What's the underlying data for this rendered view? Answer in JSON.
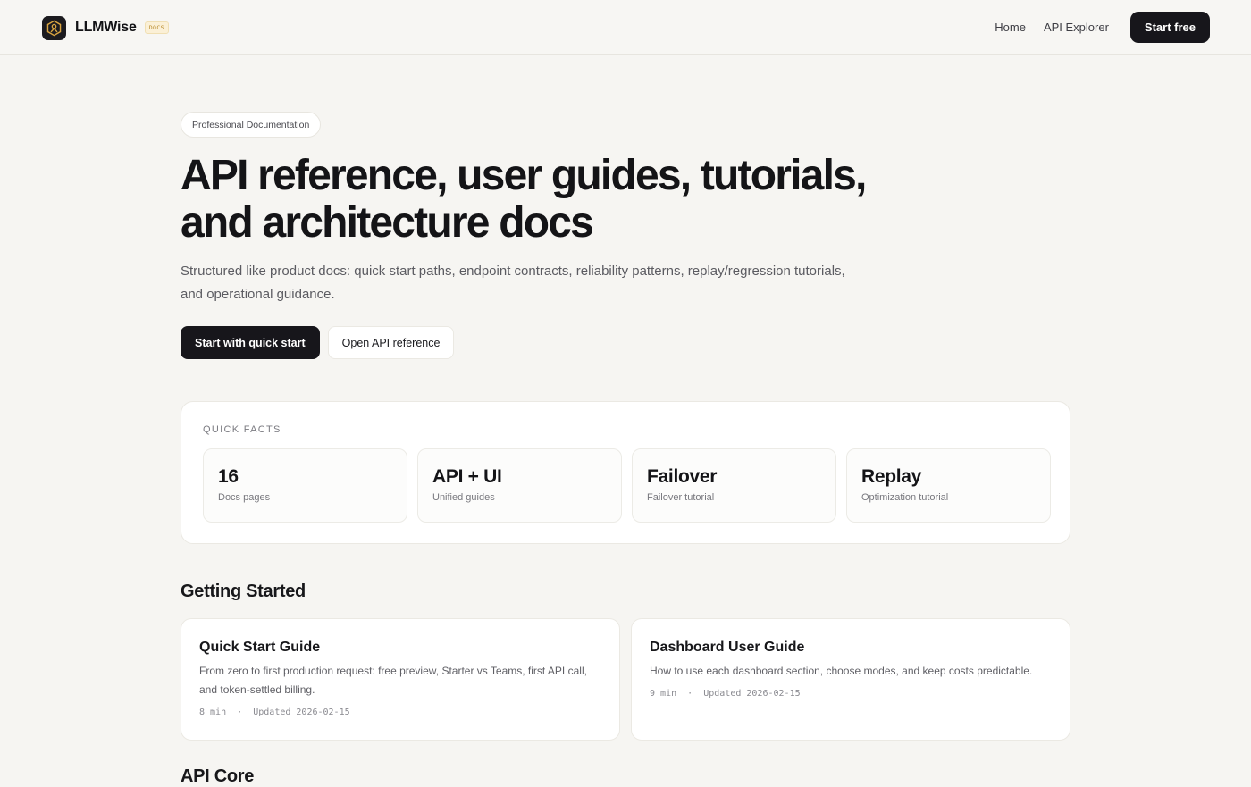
{
  "header": {
    "brand_name": "LLMWise",
    "brand_badge": "DOCS",
    "nav": [
      {
        "label": "Home"
      },
      {
        "label": "API Explorer"
      }
    ],
    "cta_label": "Start free"
  },
  "hero": {
    "eyebrow": "Professional Documentation",
    "title_line1": "API reference, user guides, tutorials,",
    "title_line2": "and architecture docs",
    "subtitle": "Structured like product docs: quick start paths, endpoint contracts, reliability patterns, replay/regression tutorials, and operational guidance.",
    "primary_button": "Start with quick start",
    "secondary_button": "Open API reference"
  },
  "quick_facts": {
    "label": "QUICK FACTS",
    "items": [
      {
        "value": "16",
        "caption": "Docs pages"
      },
      {
        "value": "API + UI",
        "caption": "Unified guides"
      },
      {
        "value": "Failover",
        "caption": "Failover tutorial"
      },
      {
        "value": "Replay",
        "caption": "Optimization tutorial"
      }
    ]
  },
  "sections": {
    "getting_started": {
      "title": "Getting Started",
      "cards": [
        {
          "title": "Quick Start Guide",
          "description": "From zero to first production request: free preview, Starter vs Teams, first API call, and token-settled billing.",
          "duration": "8 min",
          "separator": "·",
          "updated": "Updated 2026-02-15"
        },
        {
          "title": "Dashboard User Guide",
          "description": "How to use each dashboard section, choose modes, and keep costs predictable.",
          "duration": "9 min",
          "separator": "·",
          "updated": "Updated 2026-02-15"
        }
      ]
    },
    "api_core": {
      "title": "API Core"
    }
  },
  "colors": {
    "background": "#f6f5f2",
    "primary_dark": "#17161b",
    "badge_accent": "#b88a2a",
    "logo_accent": "#d9a441"
  },
  "icons": {
    "brand_logo": "hexagon-robot-icon"
  }
}
